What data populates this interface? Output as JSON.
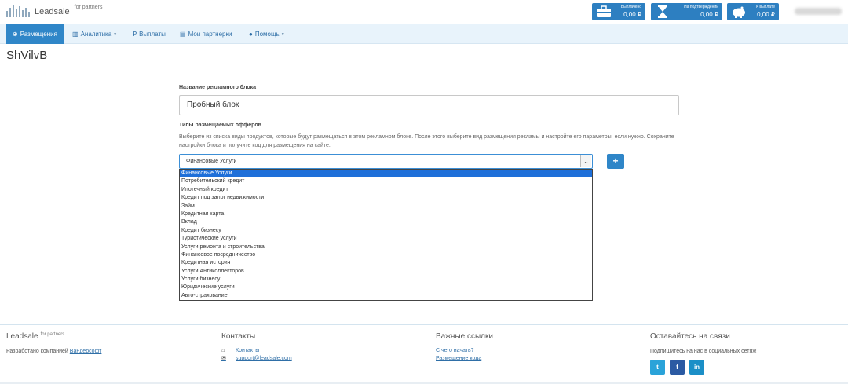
{
  "brand": {
    "name": "Leadsale",
    "sub": "for partners"
  },
  "stats": [
    {
      "label": "Выплачено",
      "value": "0,00 ₽",
      "icon": "briefcase-icon"
    },
    {
      "label": "На подтверждении",
      "value": "0,00 ₽",
      "icon": "hourglass-icon"
    },
    {
      "label": "К выплате",
      "value": "0,00 ₽",
      "icon": "piggy-bank-icon"
    }
  ],
  "nav": {
    "items": [
      {
        "label": "Размещения",
        "icon": "globe-icon"
      },
      {
        "label": "Аналитика",
        "icon": "bar-chart-icon"
      },
      {
        "label": "Выплаты",
        "icon": "ruble-icon"
      },
      {
        "label": "Мои партнерки",
        "icon": "id-card-icon"
      },
      {
        "label": "Помощь",
        "icon": "info-icon"
      }
    ]
  },
  "page": {
    "title": "ShVilvB"
  },
  "form": {
    "name_label": "Название рекламного блока",
    "name_value": "Пробный блок",
    "types_label": "Типы размещаемых офферов",
    "types_help": "Выберите из списка виды продуктов, которые будут размещаться в этом рекламном блоке. После этого выберите вид размещения рекламы и настройте его параметры, если нужно. Сохраните настройки блока и получите код для размещения на сайте.",
    "select_value": "Финансовые Услуги",
    "add_label": "+",
    "options": [
      "Финансовые Услуги",
      "Потребительский кредит",
      "Ипотечный кредит",
      "Кредит под залог недвижимости",
      "Займ",
      "Кредитная карта",
      "Вклад",
      "Кредит бизнесу",
      "Туристические услуги",
      "Услуги ремонта и строительства",
      "Финансовое посредничество",
      "Кредитная история",
      "Услуги Антиколлекторов",
      "Услуги бизнесу",
      "Юридические услуги",
      "Авто-страхование"
    ]
  },
  "footer": {
    "brand": {
      "name": "Leadsale",
      "sub": "for partners",
      "dev_text": "Разработано компанией",
      "dev_link": "Вандерсофт"
    },
    "contacts": {
      "title": "Контакты",
      "link1": "Контакты",
      "link2": "support@leadsale.com"
    },
    "links": {
      "title": "Важные ссылки",
      "link1": "С чего начать?",
      "link2": "Размещение кода"
    },
    "social": {
      "title": "Оставайтесь на связи",
      "text": "Подпишитесь на нас в социальных сетях!",
      "tw": "t",
      "fb": "f",
      "li": "in"
    }
  },
  "colors": {
    "accent": "#2f86c8",
    "nav_bg": "#e8f3fb",
    "selected_option": "#1e6fd9"
  }
}
